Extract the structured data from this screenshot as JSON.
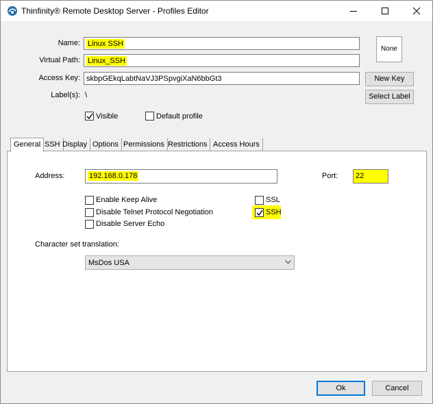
{
  "window": {
    "title": "Thinfinity® Remote Desktop Server - Profiles Editor"
  },
  "profile": {
    "name_label": "Name:",
    "name_value": "Linux SSH",
    "virtual_path_label": "Virtual Path:",
    "virtual_path_value": "Linux_SSH",
    "access_key_label": "Access Key:",
    "access_key_value": "skbpGEkqLabtNaVJ3PSpvgiXaN6bbGt3",
    "labels_label": "Label(s):",
    "labels_value": "\\",
    "icon_placeholder": "None",
    "new_key_button": "New Key",
    "select_label_button": "Select Label",
    "visible_label": "Visible",
    "visible_checked": true,
    "default_profile_label": "Default profile",
    "default_profile_checked": false
  },
  "tabs": [
    {
      "label": "General",
      "active": true
    },
    {
      "label": "SSH",
      "active": false
    },
    {
      "label": "Display",
      "active": false
    },
    {
      "label": "Options",
      "active": false
    },
    {
      "label": "Permissions",
      "active": false
    },
    {
      "label": "Restrictions",
      "active": false
    },
    {
      "label": "Access Hours",
      "active": false
    }
  ],
  "general": {
    "address_label": "Address:",
    "address_value": "192.168.0.178",
    "port_label": "Port:",
    "port_value": "22",
    "options": [
      {
        "label": "Enable Keep Alive",
        "checked": false
      },
      {
        "label": "Disable Telnet Protocol Negotiation",
        "checked": false
      },
      {
        "label": "Disable Server Echo",
        "checked": false
      }
    ],
    "protocols": [
      {
        "label": "SSL",
        "checked": false
      },
      {
        "label": "SSH",
        "checked": true
      }
    ],
    "charset_label": "Character set translation:",
    "charset_value": "MsDos USA"
  },
  "footer": {
    "ok_button": "Ok",
    "cancel_button": "Cancel"
  },
  "colors": {
    "highlight": "#ffff00",
    "default_button_border": "#0078d7"
  }
}
